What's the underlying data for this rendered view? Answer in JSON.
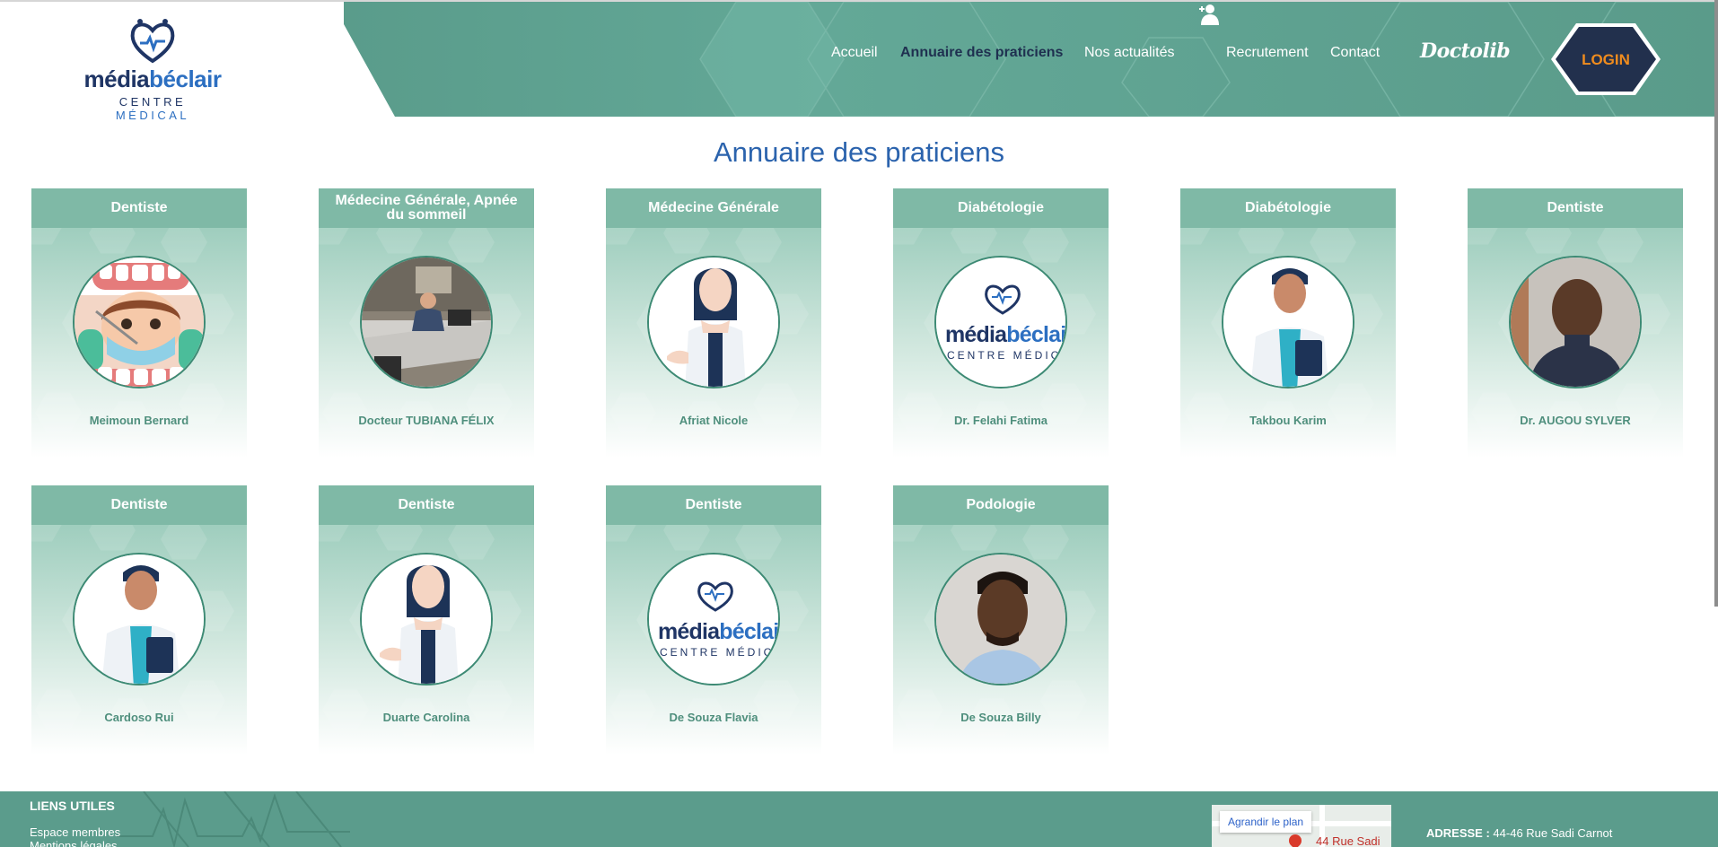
{
  "header": {
    "logo": {
      "word_part1": "média",
      "word_part2": "béclair",
      "sub_part1": "CENTRE",
      "sub_part2": "MÉDICAL"
    },
    "nav": [
      {
        "label": "Accueil",
        "active": false
      },
      {
        "label": "Annuaire des praticiens",
        "active": true
      },
      {
        "label": "Nos actualités",
        "active": false
      },
      {
        "label": "Recrutement",
        "active": false,
        "icon": "user-plus-icon"
      },
      {
        "label": "Contact",
        "active": false
      }
    ],
    "doctolib": "Doctolib",
    "login": "LOGIN"
  },
  "main": {
    "title": "Annuaire des praticiens",
    "practitioners": [
      {
        "specialty": "Dentiste",
        "name": "Meimoun Bernard",
        "avatar": "dentist-cartoon"
      },
      {
        "specialty": "Médecine Générale, Apnée du sommeil",
        "name": "Docteur TUBIANA FÉLIX",
        "avatar": "office-photo"
      },
      {
        "specialty": "Médecine Générale",
        "name": "Afriat Nicole",
        "avatar": "female-doctor-illustration"
      },
      {
        "specialty": "Diabétologie",
        "name": "Dr. Felahi Fatima",
        "avatar": "center-logo"
      },
      {
        "specialty": "Diabétologie",
        "name": "Takbou Karim",
        "avatar": "male-doctor-illustration"
      },
      {
        "specialty": "Dentiste",
        "name": "Dr. AUGOU SYLVER",
        "avatar": "man-photo"
      },
      {
        "specialty": "Dentiste",
        "name": "Cardoso Rui",
        "avatar": "male-doctor-illustration"
      },
      {
        "specialty": "Dentiste",
        "name": "Duarte Carolina",
        "avatar": "female-doctor-illustration"
      },
      {
        "specialty": "Dentiste",
        "name": "De Souza Flavia",
        "avatar": "center-logo"
      },
      {
        "specialty": "Podologie",
        "name": "De Souza Billy",
        "avatar": "young-man-photo"
      }
    ],
    "avatar_logo_text": {
      "word_part1": "média",
      "word_part2": "béclai",
      "sub": "CENTRE MÉDIC"
    }
  },
  "footer": {
    "title": "LIENS UTILES",
    "links": [
      "Espace membres",
      "Mentions légales"
    ],
    "map": {
      "button": "Agrandir le plan",
      "address_snippet": "44 Rue Sadi"
    },
    "address_label": "ADRESSE :",
    "address_value": "44-46 Rue Sadi Carnot"
  },
  "colors": {
    "brand_teal": "#5b9c8c",
    "brand_navy": "#1f3565",
    "brand_blue": "#2c6fc1",
    "login_orange": "#f08c1e"
  }
}
